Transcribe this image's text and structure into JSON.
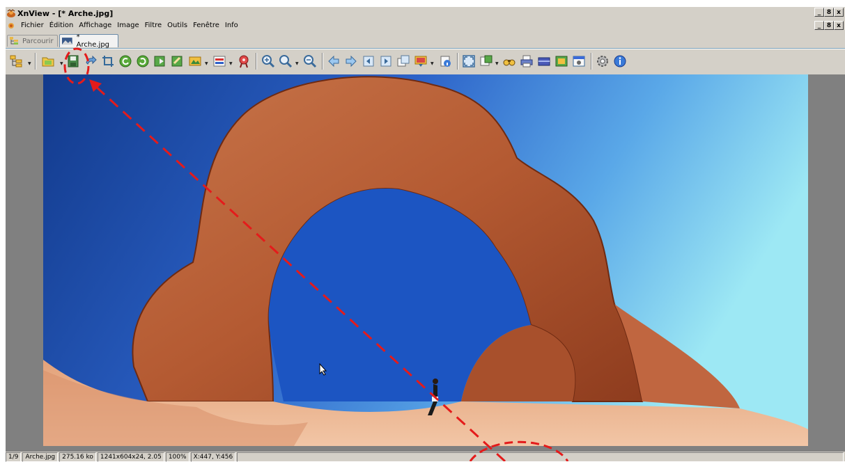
{
  "window": {
    "title": "XnView - [* Arche.jpg]",
    "controls": [
      "_",
      "8",
      "x"
    ]
  },
  "menu": {
    "items": [
      "Fichier",
      "Édition",
      "Affichage",
      "Image",
      "Filtre",
      "Outils",
      "Fenêtre",
      "Info"
    ]
  },
  "tabs": [
    {
      "label": "Parcourir",
      "active": false
    },
    {
      "label": "* Arche.jpg",
      "active": true
    }
  ],
  "toolbar": {
    "icons": [
      "browser-tree-icon",
      "open-folder-icon",
      "save-icon",
      "undo-icon",
      "crop-icon",
      "rotate-left-icon",
      "rotate-right-icon",
      "export-icon",
      "edit-icon",
      "slideshow-icon",
      "color-adjust-icon",
      "effects-icon",
      "zoom-in-icon",
      "zoom-fit-icon",
      "zoom-out-icon",
      "previous-icon",
      "next-icon",
      "first-icon",
      "last-icon",
      "copy-icon",
      "wallpaper-icon",
      "info-icon",
      "fullscreen-icon",
      "convert-icon",
      "search-icon",
      "print-icon",
      "scanner-icon",
      "capture-icon",
      "screen-icon",
      "settings-icon",
      "about-icon"
    ]
  },
  "status": {
    "index": "1/9",
    "filename": "Arche.jpg",
    "filesize": "275.16 ko",
    "dimensions": "1241x604x24, 2.05",
    "zoom": "100%",
    "cursor": "X:447, Y:456"
  },
  "annotation": {
    "color": "#e41b1b"
  }
}
